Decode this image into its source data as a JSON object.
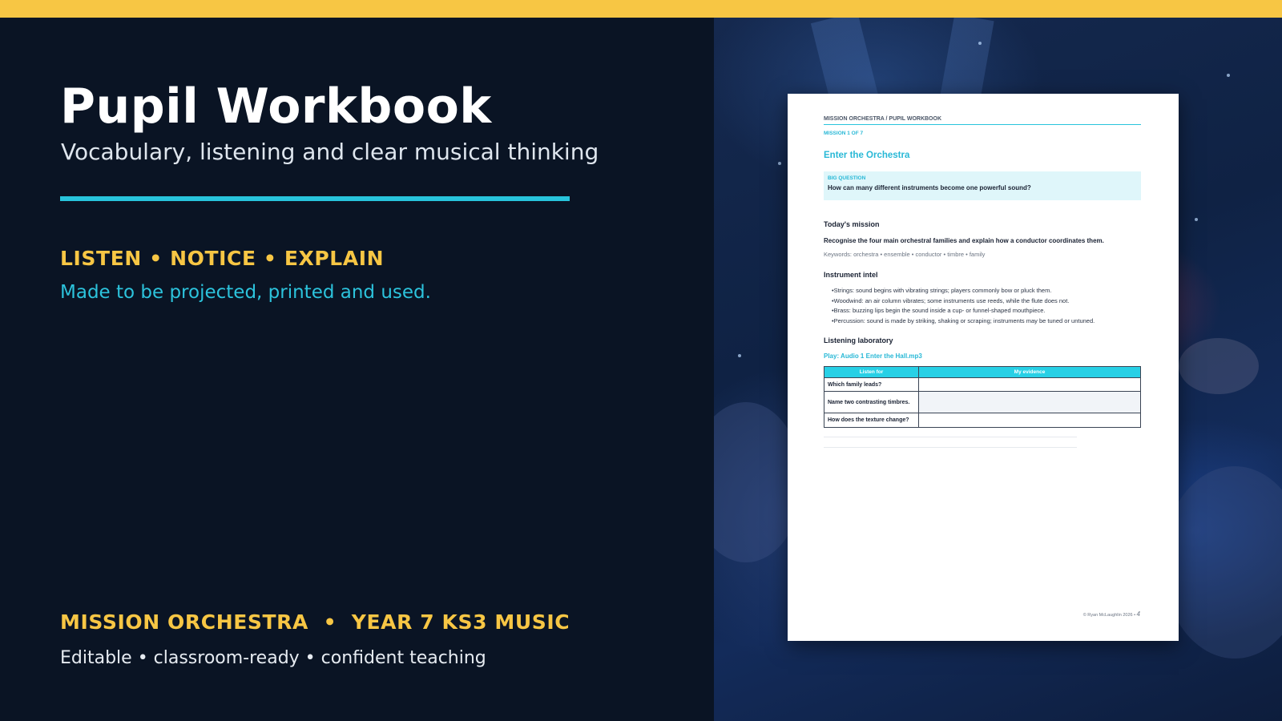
{
  "hero": {
    "title": "Pupil Workbook",
    "subtitle": "Vocabulary, listening and clear musical thinking",
    "tagline": "LISTEN • NOTICE • EXPLAIN",
    "tagline_sub": "Made to be projected, printed and used.",
    "footer_title": "MISSION ORCHESTRA  •  YEAR 7 KS3 MUSIC",
    "footer_sub": "Editable • classroom-ready • confident teaching"
  },
  "colors": {
    "accent_yellow": "#f7c644",
    "accent_cyan": "#28c4dc",
    "background_navy": "#0a1424"
  },
  "document": {
    "header": "MISSION ORCHESTRA  /  PUPIL WORKBOOK",
    "mission_number": "MISSION 1 OF 7",
    "title": "Enter the Orchestra",
    "big_question_label": "BIG QUESTION",
    "big_question": "How can many different instruments become one powerful sound?",
    "todays_mission_heading": "Today's mission",
    "todays_mission": "Recognise the four main orchestral families and explain how a conductor coordinates them.",
    "keywords": "Keywords: orchestra • ensemble • conductor • timbre • family",
    "instrument_intel_heading": "Instrument intel",
    "instrument_intel": [
      "Strings: sound begins with vibrating strings; players commonly bow or pluck them.",
      "Woodwind: an air column vibrates; some instruments use reeds, while the flute does not.",
      "Brass: buzzing lips begin the sound inside a cup- or funnel-shaped mouthpiece.",
      "Percussion: sound is made by striking, shaking or scraping; instruments may be tuned or untuned."
    ],
    "listening_heading": "Listening laboratory",
    "play_label": "Play: Audio 1 Enter the Hall.mp3",
    "table": {
      "headers": [
        "Listen for",
        "My evidence"
      ],
      "rows": [
        [
          "Which family leads?",
          ""
        ],
        [
          "Name two contrasting timbres.",
          ""
        ],
        [
          "How does the texture change?",
          ""
        ]
      ]
    },
    "footer_credit": "© Ryan McLaughlin 2026 •",
    "page_number": "4"
  }
}
